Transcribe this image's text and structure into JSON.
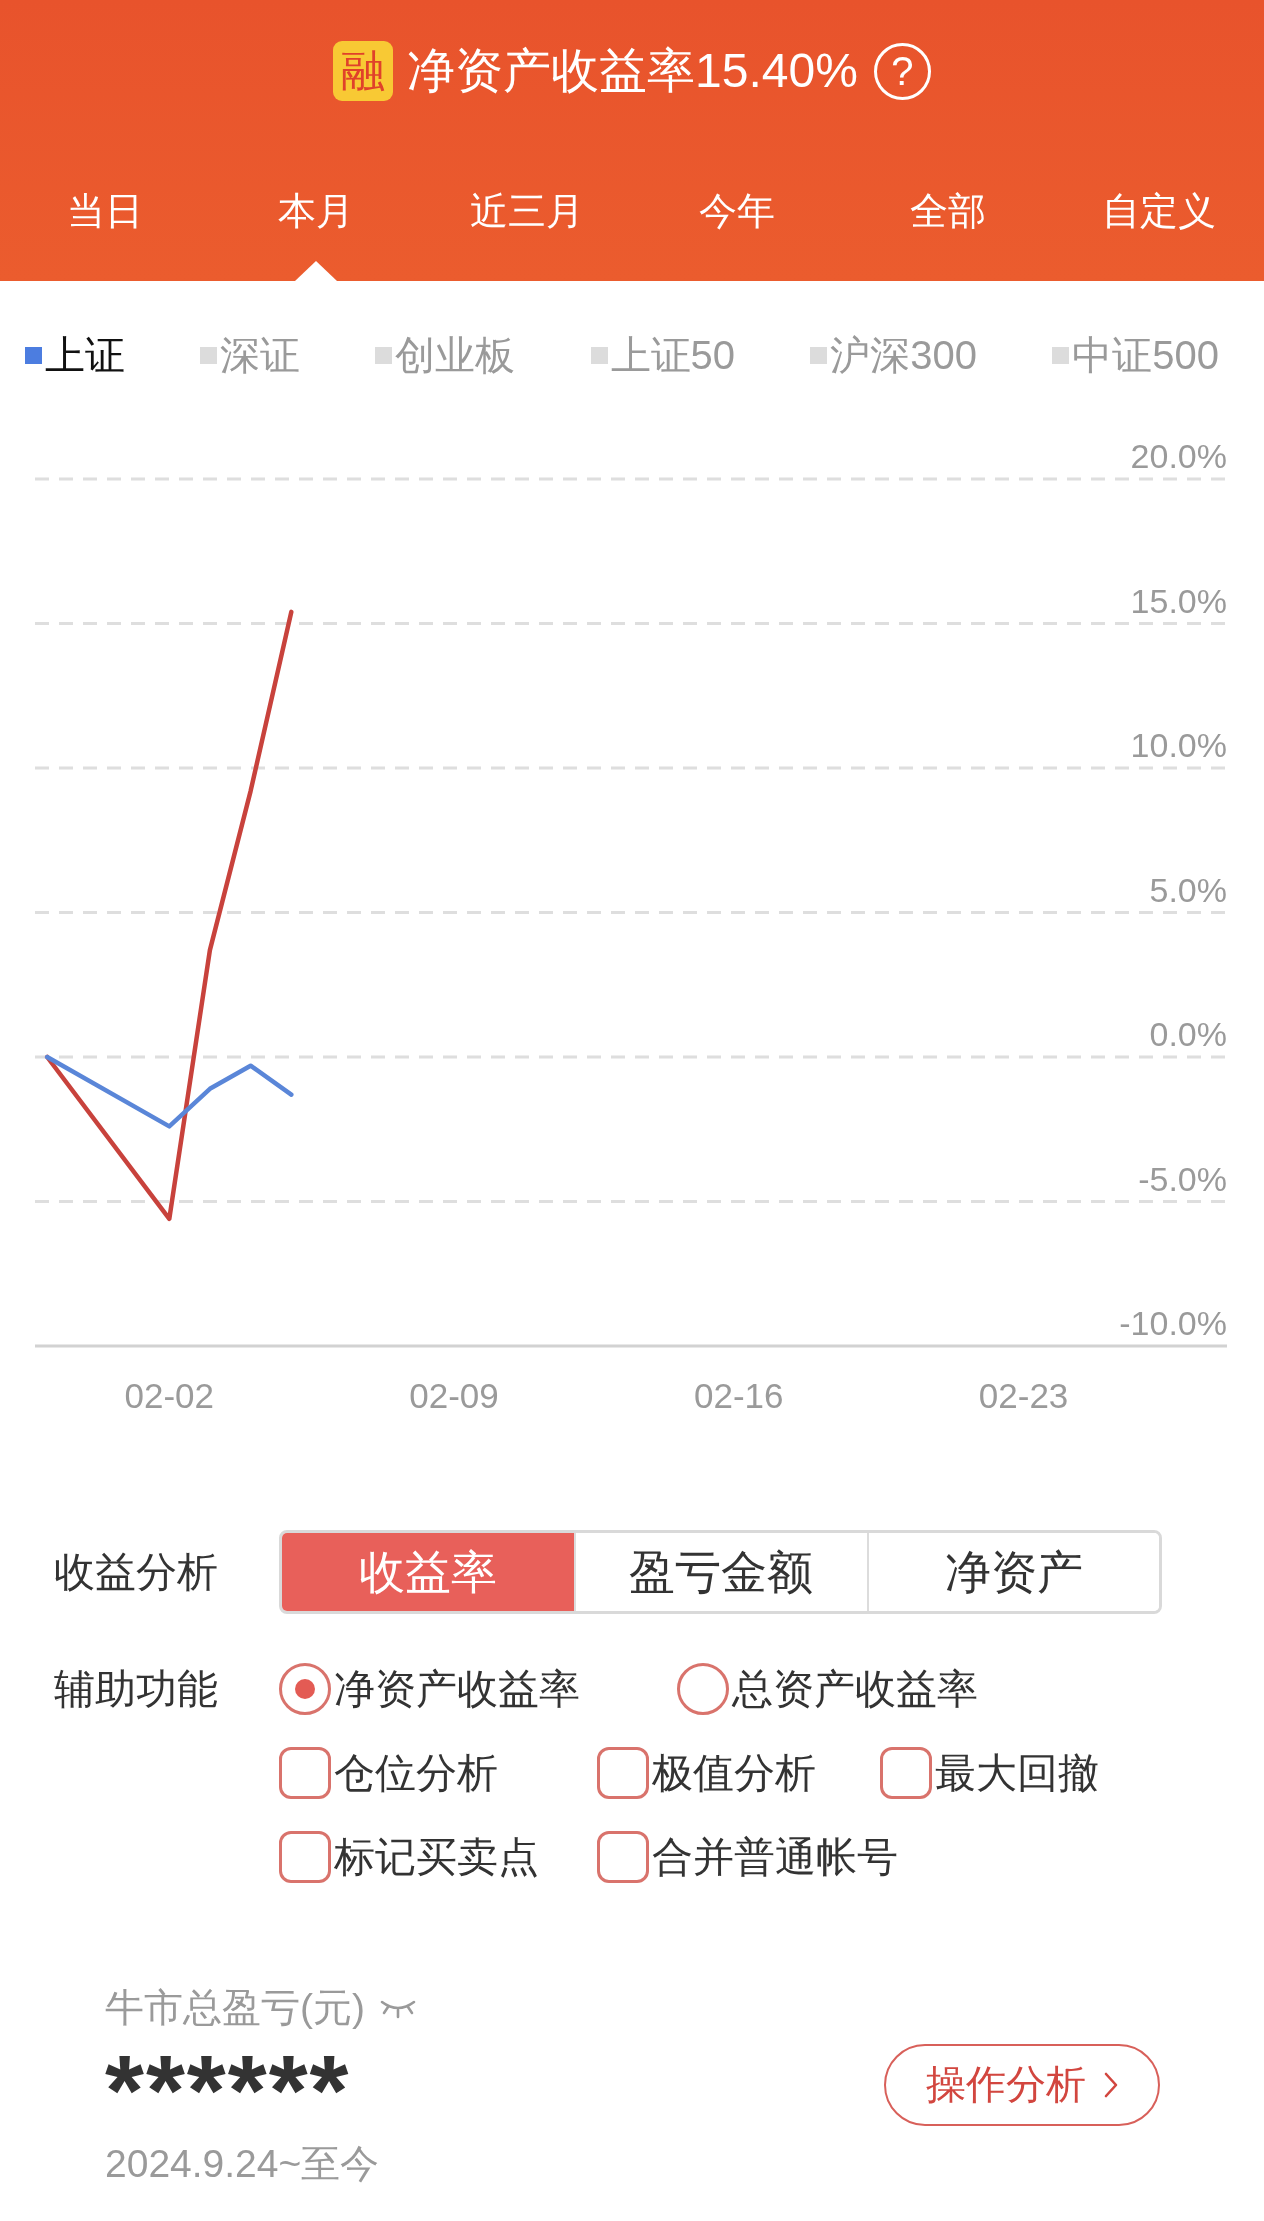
{
  "header": {
    "badge": "融",
    "title": "净资产收益率15.40%",
    "help": "?"
  },
  "tabs": [
    {
      "label": "当日",
      "selected": false
    },
    {
      "label": "本月",
      "selected": true
    },
    {
      "label": "近三月",
      "selected": false
    },
    {
      "label": "今年",
      "selected": false
    },
    {
      "label": "全部",
      "selected": false
    },
    {
      "label": "自定义",
      "selected": false
    }
  ],
  "legend": [
    {
      "label": "上证",
      "selected": true
    },
    {
      "label": "深证",
      "selected": false
    },
    {
      "label": "创业板",
      "selected": false
    },
    {
      "label": "上证50",
      "selected": false
    },
    {
      "label": "沪深300",
      "selected": false
    },
    {
      "label": "中证500",
      "selected": false
    }
  ],
  "chart": {
    "chart_data": {
      "type": "line",
      "grid": true,
      "categories": [
        null,
        null,
        null,
        "02-02",
        null,
        null,
        null,
        null,
        null,
        null,
        "02-09",
        null,
        null,
        null,
        null,
        null,
        null,
        "02-16",
        null,
        null,
        null,
        null,
        null,
        null,
        "02-23",
        null,
        null,
        null,
        null,
        null
      ],
      "series": [
        {
          "color": "#c8423c",
          "values": [
            0,
            null,
            null,
            -5.6,
            3.7,
            9.2,
            15.4,
            null,
            null,
            null,
            null,
            null,
            null,
            null,
            null,
            null,
            null,
            null,
            null,
            null,
            null,
            null,
            null,
            null,
            null,
            null,
            null,
            null,
            null,
            null
          ]
        },
        {
          "color": "#5a86d8",
          "values": [
            0,
            null,
            null,
            -2.4,
            -1.1,
            -0.3,
            -1.3,
            null,
            null,
            null,
            null,
            null,
            null,
            null,
            null,
            null,
            null,
            null,
            null,
            null,
            null,
            null,
            null,
            null,
            null,
            null,
            null,
            null,
            null,
            null
          ]
        }
      ],
      "ylim": [
        -10,
        20
      ],
      "yticks": [
        {
          "value": 20,
          "label": "20.0%"
        },
        {
          "value": 15,
          "label": "15.0%"
        },
        {
          "value": 10,
          "label": "10.0%"
        },
        {
          "value": 5,
          "label": "5.0%"
        },
        {
          "value": 0,
          "label": "0.0%"
        },
        {
          "value": -5,
          "label": "-5.0%"
        },
        {
          "value": -10,
          "label": "-10.0%"
        }
      ]
    }
  },
  "analysis": {
    "label": "收益分析",
    "options": [
      {
        "label": "收益率",
        "selected": true
      },
      {
        "label": "盈亏金额",
        "selected": false
      },
      {
        "label": "净资产",
        "selected": false
      }
    ]
  },
  "aux": {
    "label": "辅助功能",
    "radios": [
      {
        "label": "净资产收益率",
        "selected": true
      },
      {
        "label": "总资产收益率",
        "selected": false
      }
    ],
    "checkboxes": [
      {
        "label": "仓位分析",
        "checked": false
      },
      {
        "label": "极值分析",
        "checked": false
      },
      {
        "label": "最大回撤",
        "checked": false
      },
      {
        "label": "标记买卖点",
        "checked": false
      },
      {
        "label": "合并普通帐号",
        "checked": false
      }
    ]
  },
  "summary": {
    "label": "牛市总盈亏(元)",
    "value": "******",
    "period": "2024.9.24~至今",
    "button": "操作分析"
  }
}
